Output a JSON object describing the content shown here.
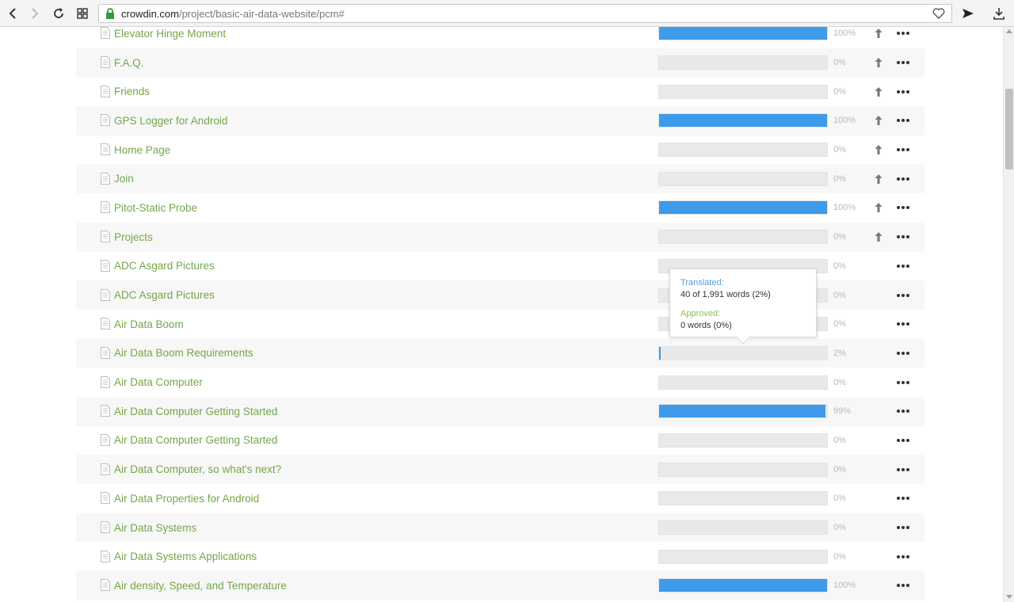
{
  "browser": {
    "url_host": "crowdin.com",
    "url_path": "/project/basic-air-data-website/pcm#"
  },
  "colors": {
    "progress_fill": "#3d9be9",
    "file_name": "#74a64a"
  },
  "files": [
    {
      "name": "Elevator Hinge Moment",
      "percent": "100%",
      "progress": 1.0,
      "upload": true
    },
    {
      "name": "F.A.Q.",
      "percent": "0%",
      "progress": 0,
      "upload": true
    },
    {
      "name": "Friends",
      "percent": "0%",
      "progress": 0,
      "upload": true
    },
    {
      "name": "GPS Logger for Android",
      "percent": "100%",
      "progress": 1.0,
      "upload": true
    },
    {
      "name": "Home Page",
      "percent": "0%",
      "progress": 0,
      "upload": true
    },
    {
      "name": "Join",
      "percent": "0%",
      "progress": 0,
      "upload": true
    },
    {
      "name": "Pitot-Static Probe",
      "percent": "100%",
      "progress": 1.0,
      "upload": true
    },
    {
      "name": "Projects",
      "percent": "0%",
      "progress": 0,
      "upload": true
    },
    {
      "name": "ADC Asgard Pictures",
      "percent": "0%",
      "progress": 0,
      "upload": false
    },
    {
      "name": "ADC Asgard Pictures",
      "percent": "0%",
      "progress": 0,
      "upload": false
    },
    {
      "name": "Air Data Boom",
      "percent": "0%",
      "progress": 0,
      "upload": false
    },
    {
      "name": "Air Data Boom Requirements",
      "percent": "2%",
      "progress": 0.02,
      "upload": false
    },
    {
      "name": "Air Data Computer",
      "percent": "0%",
      "progress": 0,
      "upload": false
    },
    {
      "name": "Air Data Computer Getting Started",
      "percent": "99%",
      "progress": 0.99,
      "upload": false
    },
    {
      "name": "Air Data Computer Getting Started",
      "percent": "0%",
      "progress": 0,
      "upload": false
    },
    {
      "name": "Air Data Computer, so what's next?",
      "percent": "0%",
      "progress": 0,
      "upload": false
    },
    {
      "name": "Air Data Properties for Android",
      "percent": "0%",
      "progress": 0,
      "upload": false
    },
    {
      "name": "Air Data Systems",
      "percent": "0%",
      "progress": 0,
      "upload": false
    },
    {
      "name": "Air Data Systems Applications",
      "percent": "0%",
      "progress": 0,
      "upload": false
    },
    {
      "name": "Air density, Speed, and Temperature",
      "percent": "100%",
      "progress": 1.0,
      "upload": false
    }
  ],
  "tooltip": {
    "translated_label": "Translated:",
    "translated_value": "40 of 1,991 words (2%)",
    "approved_label": "Approved:",
    "approved_value": "0 words (0%)"
  }
}
